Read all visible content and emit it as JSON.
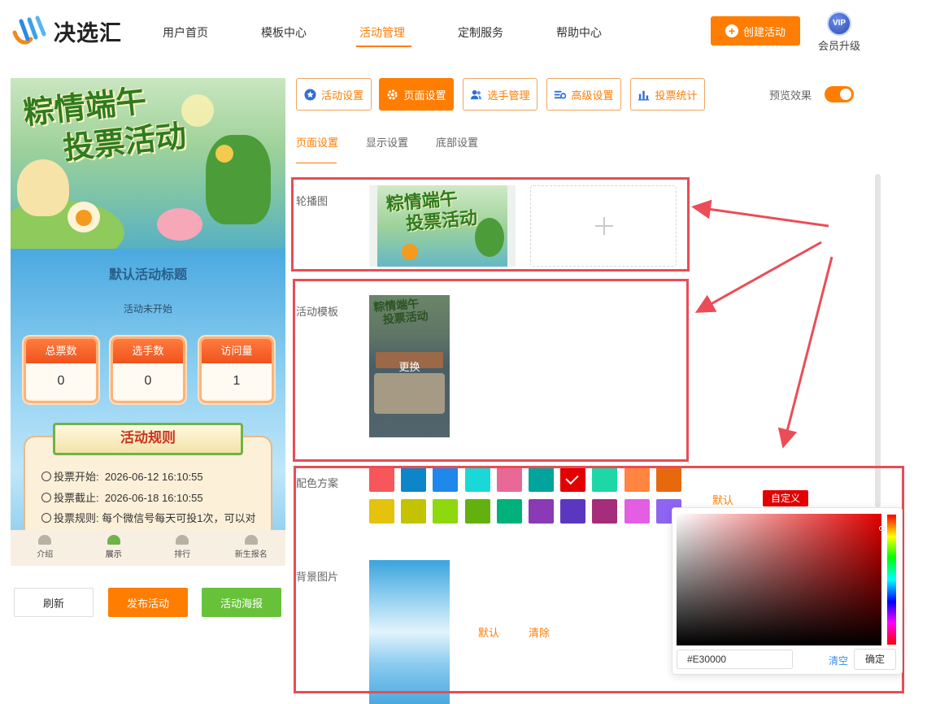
{
  "brand": {
    "name": "决选汇"
  },
  "nav": {
    "items": [
      {
        "label": "用户首页"
      },
      {
        "label": "模板中心"
      },
      {
        "label": "活动管理"
      },
      {
        "label": "定制服务"
      },
      {
        "label": "帮助中心"
      }
    ],
    "active_index": 2
  },
  "header": {
    "create_label": "创建活动",
    "vip_badge": "VIP",
    "vip_label": "会员升级"
  },
  "preview": {
    "banner_line1": "粽情端午",
    "banner_line2": "投票活动",
    "activity_title": "默认活动标题",
    "status": "活动未开始",
    "stats": [
      {
        "label": "总票数",
        "value": "0"
      },
      {
        "label": "选手数",
        "value": "0"
      },
      {
        "label": "访问量",
        "value": "1"
      }
    ],
    "rules_title": "活动规则",
    "rules": [
      {
        "label": "投票开始:",
        "value": "2026-06-12 16:10:55"
      },
      {
        "label": "投票截止:",
        "value": "2026-06-18 16:10:55"
      },
      {
        "label": "投票规则:",
        "value": "每个微信号每天可投1次，可以对"
      }
    ],
    "tabs": [
      {
        "label": "介绍"
      },
      {
        "label": "展示"
      },
      {
        "label": "排行"
      },
      {
        "label": "新生报名"
      }
    ]
  },
  "left_actions": {
    "refresh": "刷新",
    "publish": "发布活动",
    "poster": "活动海报"
  },
  "settings_tabs": [
    {
      "label": "活动设置",
      "icon": "star-icon"
    },
    {
      "label": "页面设置",
      "icon": "gear-icon"
    },
    {
      "label": "选手管理",
      "icon": "users-icon"
    },
    {
      "label": "高级设置",
      "icon": "sliders-icon"
    },
    {
      "label": "投票统计",
      "icon": "bar-chart-icon"
    }
  ],
  "preview_toggle": {
    "label": "预览效果",
    "on": true
  },
  "sub_tabs": [
    {
      "label": "页面设置"
    },
    {
      "label": "显示设置"
    },
    {
      "label": "底部设置"
    }
  ],
  "form": {
    "carousel_label": "轮播图",
    "template_label": "活动模板",
    "template_change": "更换",
    "color_label": "配色方案",
    "color_default": "默认",
    "color_custom": "自定义",
    "bg_label": "背景图片",
    "bg_default": "默认",
    "bg_clear": "清除"
  },
  "palette": {
    "row1": [
      "#f7565b",
      "#0c86c8",
      "#1f88ea",
      "#1ad8d8",
      "#e86996",
      "#00a49c",
      "#e30000",
      "#1dd7a6",
      "#ff8540",
      "#e7690e"
    ],
    "row2": [
      "#e5c20b",
      "#c3c300",
      "#8dd80e",
      "#63b10e",
      "#00b17c",
      "#8a3ab5",
      "#5b37c0",
      "#a62c7c",
      "#e35ee2",
      "#8f64f0"
    ],
    "selected": "#e30000"
  },
  "color_picker": {
    "hex": "#E30000",
    "clear": "清空",
    "ok": "确定"
  }
}
